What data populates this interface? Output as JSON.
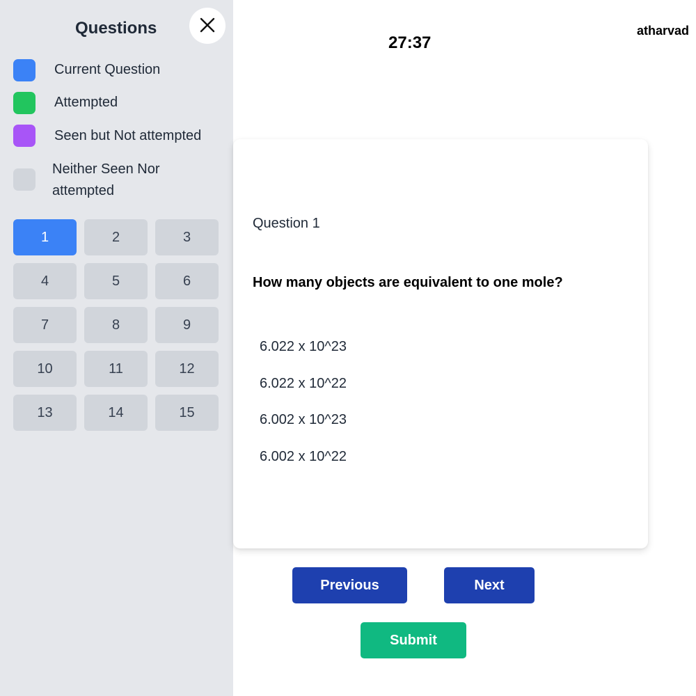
{
  "sidebar": {
    "title": "Questions",
    "close_icon": "close-icon",
    "legend": [
      {
        "label": "Current Question",
        "color": "#3b82f6"
      },
      {
        "label": "Attempted",
        "color": "#22c55e"
      },
      {
        "label": "Seen but Not attempted",
        "color": "#a855f7"
      },
      {
        "label": "Neither Seen Nor attempted",
        "color": "#d1d5db"
      }
    ],
    "questions": [
      "1",
      "2",
      "3",
      "4",
      "5",
      "6",
      "7",
      "8",
      "9",
      "10",
      "11",
      "12",
      "13",
      "14",
      "15"
    ],
    "current_question": "1"
  },
  "header": {
    "timer": "27:37",
    "username": "atharvad"
  },
  "question": {
    "number_label": "Question 1",
    "text": "How many objects are equivalent to one mole?",
    "options": [
      "6.022 x 10^23",
      "6.022 x 10^22",
      "6.002 x 10^23",
      "6.002 x 10^22"
    ]
  },
  "actions": {
    "previous_label": "Previous",
    "next_label": "Next",
    "submit_label": "Submit"
  },
  "colors": {
    "sidebar_bg": "#e5e7eb",
    "current": "#3b82f6",
    "attempted": "#22c55e",
    "seen_not_attempted": "#a855f7",
    "not_seen": "#d1d5db",
    "nav_button": "#1e40af",
    "submit_button": "#10b981"
  }
}
